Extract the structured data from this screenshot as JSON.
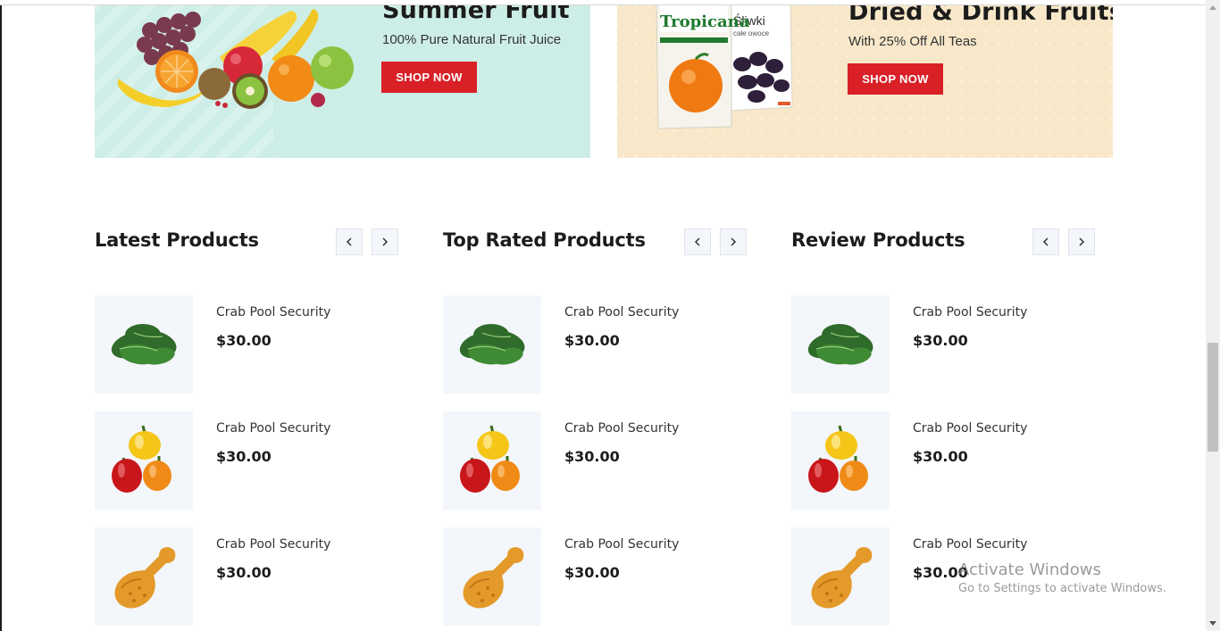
{
  "banners": [
    {
      "title": "Summer Fruit",
      "subtitle": "100% Pure Natural Fruit Juice",
      "button_label": "SHOP NOW",
      "image": "fruit-basket-image",
      "background": "#cdeee7"
    },
    {
      "title": "Dried & Drink Fruits",
      "subtitle": "With 25% Off All Teas",
      "button_label": "SHOP NOW",
      "image": "juice-and-prunes-image",
      "image_text": [
        "Tropicana",
        "Śliwki",
        "całe owoce"
      ],
      "background": "#f8e8c9"
    }
  ],
  "accent_color": "#d92027",
  "sections": [
    {
      "title": "Latest Products",
      "prev_icon": "chevron-left-icon",
      "next_icon": "chevron-right-icon",
      "products": [
        {
          "name": "Crab Pool Security",
          "price": "$30.00",
          "image": "spinach-image"
        },
        {
          "name": "Crab Pool Security",
          "price": "$30.00",
          "image": "bell-peppers-image"
        },
        {
          "name": "Crab Pool Security",
          "price": "$30.00",
          "image": "fried-chicken-image"
        }
      ]
    },
    {
      "title": "Top Rated Products",
      "prev_icon": "chevron-left-icon",
      "next_icon": "chevron-right-icon",
      "products": [
        {
          "name": "Crab Pool Security",
          "price": "$30.00",
          "image": "spinach-image"
        },
        {
          "name": "Crab Pool Security",
          "price": "$30.00",
          "image": "bell-peppers-image"
        },
        {
          "name": "Crab Pool Security",
          "price": "$30.00",
          "image": "fried-chicken-image"
        }
      ]
    },
    {
      "title": "Review Products",
      "prev_icon": "chevron-left-icon",
      "next_icon": "chevron-right-icon",
      "products": [
        {
          "name": "Crab Pool Security",
          "price": "$30.00",
          "image": "spinach-image"
        },
        {
          "name": "Crab Pool Security",
          "price": "$30.00",
          "image": "bell-peppers-image"
        },
        {
          "name": "Crab Pool Security",
          "price": "$30.00",
          "image": "fried-chicken-image"
        }
      ]
    }
  ],
  "watermark": {
    "title": "Activate Windows",
    "subtitle": "Go to Settings to activate Windows."
  }
}
